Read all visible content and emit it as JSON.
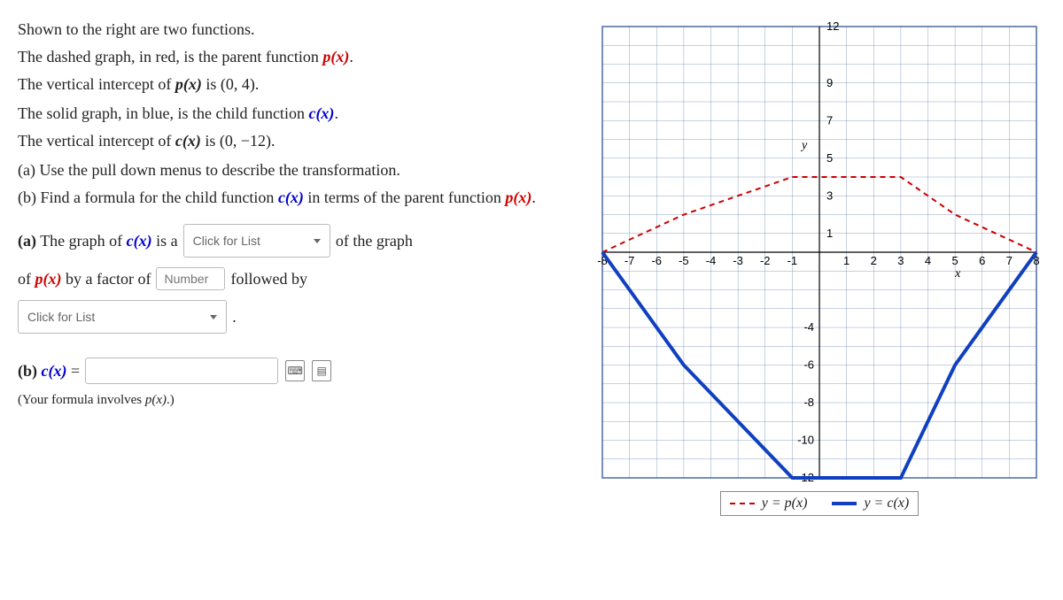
{
  "intro": {
    "l1": "Shown to the right are two functions.",
    "l2a": "The dashed graph, in red, is the parent function ",
    "l2b": "p(x)",
    "l2c": ".",
    "l3a": "The vertical intercept of ",
    "l3b": "p(x)",
    "l3c": " is (0, 4).",
    "l4a": "The solid graph, in blue, is the child function ",
    "l4b": "c(x)",
    "l4c": ".",
    "l5a": "The vertical intercept of ",
    "l5b": "c(x)",
    "l5c": " is (0, −12)."
  },
  "tasks": {
    "a": "(a) Use the pull down menus to describe the transformation.",
    "b_pre": "(b) Find a formula for the child function ",
    "b_cx": "c(x)",
    "b_mid": " in terms of the parent function ",
    "b_px": "p(x)",
    "b_end": "."
  },
  "partA": {
    "lead_a": "(a)",
    "t1": "The graph of ",
    "cx": "c(x)",
    "t2": " is a ",
    "dd1_placeholder": "Click for List",
    "t3": "of the graph",
    "t4": "of ",
    "px": "p(x)",
    "t5": " by a factor of ",
    "num_placeholder": "Number",
    "t6": " followed by",
    "dd2_placeholder": "Click for List",
    "period": "."
  },
  "partB": {
    "lead_b": "(b)",
    "cx": "c(x)",
    "eq": " = ",
    "hint_pre": "(Your formula involves ",
    "hint_px": "p(x)",
    "hint_post": ".)"
  },
  "chart_data": {
    "type": "line",
    "xlabel": "x",
    "ylabel": "y",
    "xlim": [
      -8,
      8
    ],
    "ylim": [
      -12,
      12
    ],
    "xticks": [
      -8,
      -7,
      -6,
      -5,
      -4,
      -3,
      -2,
      -1,
      0,
      1,
      2,
      3,
      4,
      5,
      6,
      7,
      8
    ],
    "yticks": [
      -12,
      -10,
      -8,
      -6,
      -4,
      1,
      3,
      5,
      7,
      9,
      12
    ],
    "series": [
      {
        "name": "y = p(x)",
        "style": "dashed-red",
        "points": [
          [
            -8,
            0
          ],
          [
            -5,
            2
          ],
          [
            -1,
            4
          ],
          [
            1,
            4
          ],
          [
            3,
            4
          ],
          [
            5,
            2
          ],
          [
            8,
            0
          ]
        ]
      },
      {
        "name": "y = c(x)",
        "style": "solid-blue",
        "points": [
          [
            -8,
            0
          ],
          [
            -5,
            -6
          ],
          [
            -1,
            -12
          ],
          [
            1,
            -12
          ],
          [
            3,
            -12
          ],
          [
            5,
            -6
          ],
          [
            8,
            0
          ]
        ]
      }
    ],
    "legend": [
      "y = p(x)",
      "y = c(x)"
    ]
  }
}
